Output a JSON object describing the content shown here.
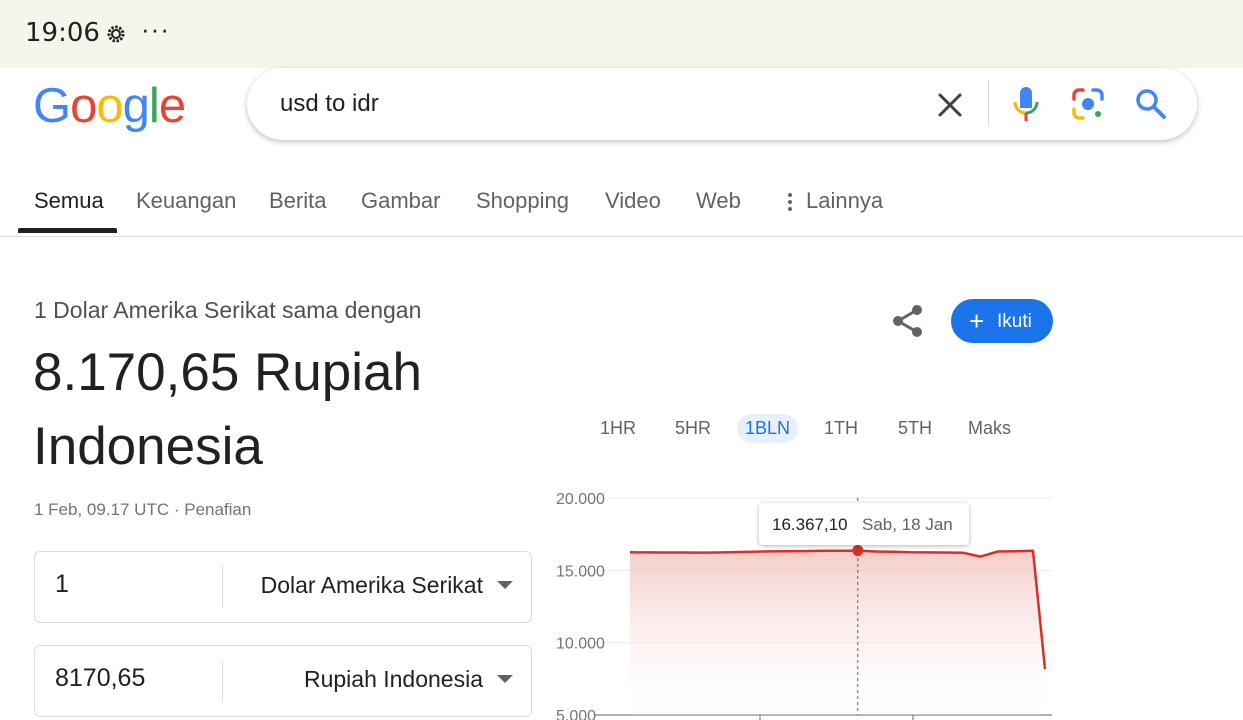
{
  "status_bar": {
    "time": "19:06",
    "more": "···"
  },
  "logo": {
    "letters": [
      "G",
      "o",
      "o",
      "g",
      "l",
      "e"
    ],
    "colors": [
      "#4285F4",
      "#EA4335",
      "#FBBC05",
      "#4285F4",
      "#34A853",
      "#EA4335"
    ]
  },
  "search": {
    "query": "usd to idr",
    "icons": [
      "close-icon",
      "mic-icon",
      "lens-icon",
      "search-icon"
    ]
  },
  "tabs": [
    {
      "label": "Semua",
      "active": true
    },
    {
      "label": "Keuangan"
    },
    {
      "label": "Berita"
    },
    {
      "label": "Gambar"
    },
    {
      "label": "Shopping"
    },
    {
      "label": "Video"
    },
    {
      "label": "Web"
    },
    {
      "label": "Lainnya"
    }
  ],
  "result": {
    "caption": "1 Dolar Amerika Serikat sama dengan",
    "value": "8.170,65 Rupiah Indonesia",
    "timestamp": "1 Feb, 09.17 UTC · Penafian",
    "follow_label": "Ikuti",
    "follow_plus": "+"
  },
  "converter": {
    "from": {
      "amount": "1",
      "currency": "Dolar Amerika Serikat"
    },
    "to": {
      "amount": "8170,65",
      "currency": "Rupiah Indonesia"
    }
  },
  "ranges": [
    {
      "label": "1HR"
    },
    {
      "label": "5HR"
    },
    {
      "label": "1BLN",
      "active": true
    },
    {
      "label": "1TH"
    },
    {
      "label": "5TH"
    },
    {
      "label": "Maks"
    }
  ],
  "tooltip": {
    "value": "16.367,10",
    "date": "Sab, 18 Jan"
  },
  "colors": {
    "accent": "#1a73e8",
    "chart_line": "#d93025",
    "chart_fill": "#f4c7c3"
  },
  "chart_data": {
    "type": "area",
    "y_ticks": [
      "20.000",
      "15.000",
      "10.000",
      "5.000"
    ],
    "ylim": [
      5000,
      20000
    ],
    "grid": true,
    "values": [
      16250,
      16240,
      16235,
      16230,
      16225,
      16230,
      16260,
      16290,
      16310,
      16320,
      16330,
      16350,
      16360,
      16367.1,
      16300,
      16280,
      16250,
      16240,
      16230,
      16220,
      15950,
      16300,
      16320,
      16350,
      8170.65
    ],
    "highlight_index": 13
  }
}
